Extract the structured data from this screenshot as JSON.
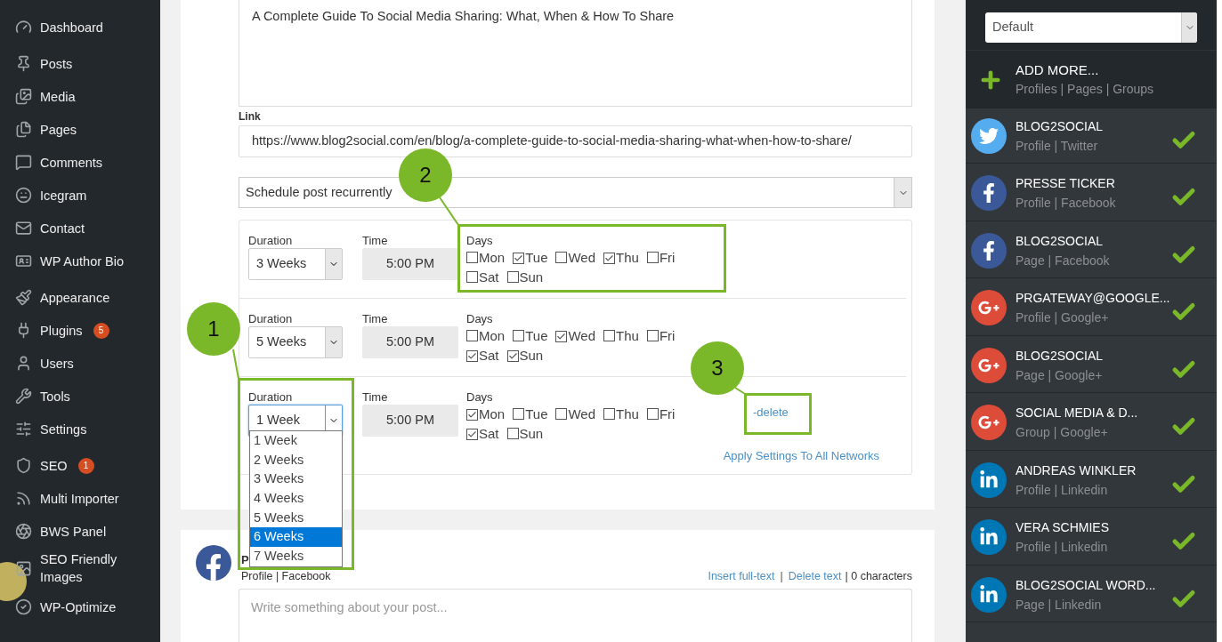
{
  "sidebar": {
    "items": [
      {
        "label": "Dashboard"
      },
      {
        "label": "Posts"
      },
      {
        "label": "Media"
      },
      {
        "label": "Pages"
      },
      {
        "label": "Comments"
      },
      {
        "label": "Icegram"
      },
      {
        "label": "Contact"
      },
      {
        "label": "WP Author Bio"
      },
      {
        "label": "Appearance"
      },
      {
        "label": "Plugins",
        "badge": "5"
      },
      {
        "label": "Users"
      },
      {
        "label": "Tools"
      },
      {
        "label": "Settings"
      },
      {
        "label": "SEO",
        "badge": "1"
      },
      {
        "label": "Multi Importer"
      },
      {
        "label": "BWS Panel"
      },
      {
        "label": "SEO Friendly Images"
      },
      {
        "label": "WP-Optimize"
      }
    ]
  },
  "editor": {
    "text": "A Complete Guide To Social Media Sharing: What, When & How To Share",
    "link_label": "Link",
    "link": "https://www.blog2social.com/en/blog/a-complete-guide-to-social-media-sharing-what-when-how-to-share/",
    "schedule_select": "Schedule post recurrently",
    "schedules": [
      {
        "duration_label": "Duration",
        "duration": "3 Weeks",
        "focused": false,
        "time_label": "Time",
        "time": "5:00 PM",
        "days_label": "Days",
        "days": [
          {
            "label": "Mon",
            "checked": false
          },
          {
            "label": "Tue",
            "checked": true
          },
          {
            "label": "Wed",
            "checked": false
          },
          {
            "label": "Thu",
            "checked": true
          },
          {
            "label": "Fri",
            "checked": false
          },
          {
            "label": "Sat",
            "checked": false
          },
          {
            "label": "Sun",
            "checked": false
          }
        ]
      },
      {
        "duration_label": "Duration",
        "duration": "5 Weeks",
        "focused": false,
        "time_label": "Time",
        "time": "5:00 PM",
        "days_label": "Days",
        "days": [
          {
            "label": "Mon",
            "checked": false
          },
          {
            "label": "Tue",
            "checked": false
          },
          {
            "label": "Wed",
            "checked": true
          },
          {
            "label": "Thu",
            "checked": false
          },
          {
            "label": "Fri",
            "checked": false
          },
          {
            "label": "Sat",
            "checked": true
          },
          {
            "label": "Sun",
            "checked": true
          }
        ]
      },
      {
        "duration_label": "Duration",
        "duration": "1 Week",
        "focused": true,
        "time_label": "Time",
        "time": "5:00 PM",
        "days_label": "Days",
        "days": [
          {
            "label": "Mon",
            "checked": true
          },
          {
            "label": "Tue",
            "checked": false
          },
          {
            "label": "Wed",
            "checked": false
          },
          {
            "label": "Thu",
            "checked": false
          },
          {
            "label": "Fri",
            "checked": false
          },
          {
            "label": "Sat",
            "checked": true
          },
          {
            "label": "Sun",
            "checked": false
          }
        ],
        "delete": "-delete"
      }
    ],
    "apply_link": "Apply Settings To All Networks"
  },
  "duration_dropdown": {
    "options": [
      {
        "label": "1 Week",
        "selected": false
      },
      {
        "label": "2 Weeks",
        "selected": false
      },
      {
        "label": "3 Weeks",
        "selected": false
      },
      {
        "label": "4 Weeks",
        "selected": false
      },
      {
        "label": "5 Weeks",
        "selected": false
      },
      {
        "label": "6 Weeks",
        "selected": true
      },
      {
        "label": "7 Weeks",
        "selected": false
      }
    ]
  },
  "post_card": {
    "name": "P",
    "subtitle": "Profile | Facebook",
    "insert_link": "Insert full-text",
    "separator": "|",
    "delete_link": "Delete text",
    "count": "| 0 characters",
    "placeholder": "Write something about your post..."
  },
  "networks_panel": {
    "select": "Default",
    "add_title": "ADD MORE...",
    "add_subtitle": "Profiles | Pages | Groups",
    "items": [
      {
        "kind": "twitter",
        "name": "BLOG2SOCIAL",
        "subtitle": "Profile | Twitter",
        "checked": true
      },
      {
        "kind": "facebook",
        "name": "PRESSE TICKER",
        "subtitle": "Profile | Facebook",
        "checked": true
      },
      {
        "kind": "facebook",
        "name": "BLOG2SOCIAL",
        "subtitle": "Page | Facebook",
        "checked": true
      },
      {
        "kind": "googleplus",
        "name": "PRGATEWAY@GOOGLE...",
        "subtitle": "Profile | Google+",
        "checked": true
      },
      {
        "kind": "googleplus",
        "name": "BLOG2SOCIAL",
        "subtitle": "Page | Google+",
        "checked": true
      },
      {
        "kind": "googleplus",
        "name": "SOCIAL MEDIA & D...",
        "subtitle": "Group | Google+",
        "checked": true
      },
      {
        "kind": "linkedin",
        "name": "ANDREAS WINKLER",
        "subtitle": "Profile | Linkedin",
        "checked": true
      },
      {
        "kind": "linkedin",
        "name": "VERA SCHMIES",
        "subtitle": "Profile | Linkedin",
        "checked": true
      },
      {
        "kind": "linkedin",
        "name": "BLOG2SOCIAL WORD...",
        "subtitle": "Page | Linkedin",
        "checked": true
      }
    ]
  },
  "callouts": [
    {
      "number": "1"
    },
    {
      "number": "2"
    },
    {
      "number": "3"
    }
  ]
}
